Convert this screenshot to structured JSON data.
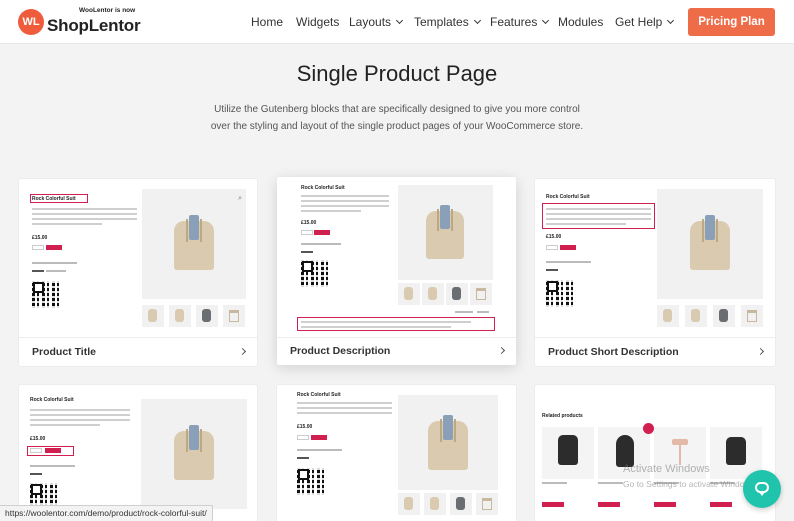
{
  "header": {
    "logo_tagline": "WooLentor is now",
    "logo_name": "ShopLentor",
    "logo_mark": "WL",
    "nav": [
      {
        "label": "Home",
        "has_dropdown": false
      },
      {
        "label": "Widgets",
        "has_dropdown": false
      },
      {
        "label": "Layouts",
        "has_dropdown": true
      },
      {
        "label": "Templates",
        "has_dropdown": true
      },
      {
        "label": "Features",
        "has_dropdown": true
      },
      {
        "label": "Modules",
        "has_dropdown": false
      },
      {
        "label": "Get Help",
        "has_dropdown": true
      }
    ],
    "cta_label": "Pricing Plan"
  },
  "hero": {
    "title": "Single Product Page",
    "subtitle": "Utilize the Gutenberg blocks that are specifically designed to give you more control over the styling and layout of the single product pages of your WooCommerce store."
  },
  "cards": [
    {
      "label": "Product Title"
    },
    {
      "label": "Product Description"
    },
    {
      "label": "Product Short Description"
    },
    {
      "label": ""
    },
    {
      "label": ""
    },
    {
      "label": ""
    }
  ],
  "preview": {
    "product_name": "Rock Colorful Suit",
    "price": "£15.00",
    "related_title": "Related products"
  },
  "overlays": {
    "watermark_title": "Activate Windows",
    "watermark_sub": "Go to Settings to activate Windows.",
    "status_url": "https://woolentor.com/demo/product/rock-colorful-suit/"
  },
  "colors": {
    "accent": "#ef6c49",
    "highlight": "#d11f4f",
    "chat": "#20c4ad"
  },
  "icons": [
    "chevron-down-icon",
    "chevron-right-icon",
    "chat-icon",
    "search-icon"
  ]
}
